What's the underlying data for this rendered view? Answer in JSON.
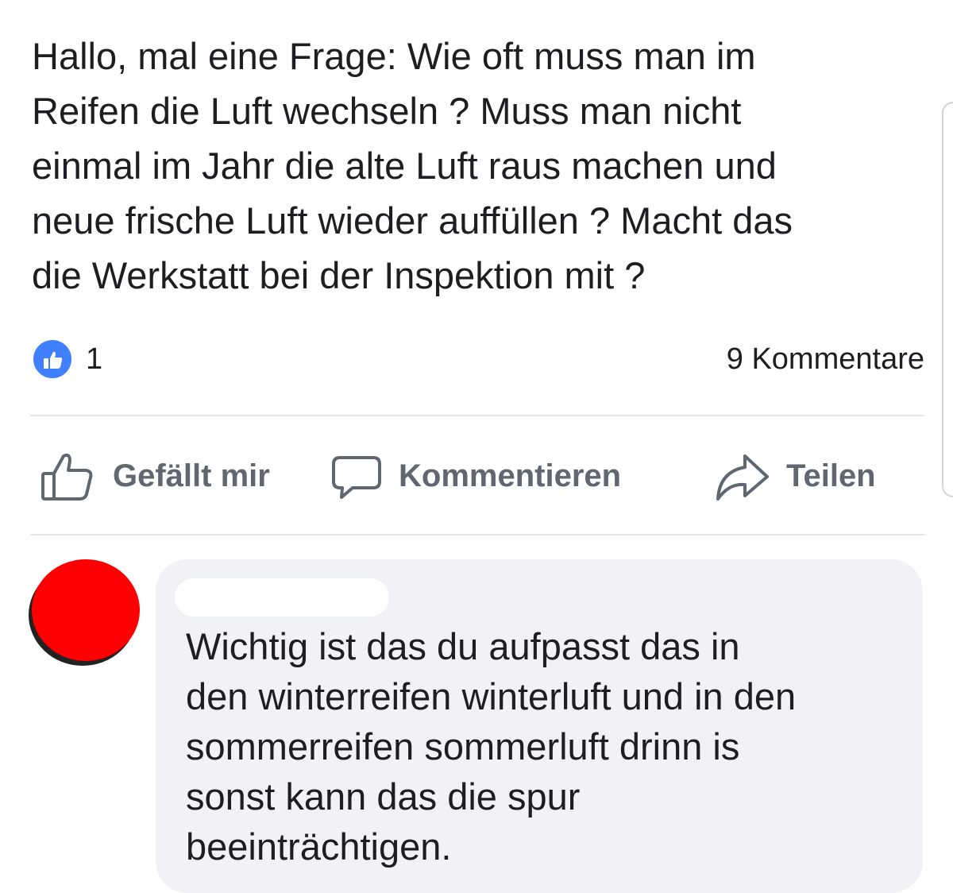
{
  "post": {
    "text_lines": [
      "Hallo, mal eine Frage: Wie oft muss man im",
      "Reifen die Luft wechseln ? Muss man nicht",
      "einmal im Jahr die alte Luft raus machen und",
      "neue frische Luft wieder auffüllen ? Macht das",
      "die Werkstatt bei der Inspektion mit ?"
    ]
  },
  "reactions": {
    "icon": "thumbs-up-icon",
    "like_count": "1",
    "comments_label": "9 Kommentare",
    "accent_color": "#4080ff"
  },
  "actions": {
    "like_label": "Gefällt mir",
    "comment_label": "Kommentieren",
    "share_label": "Teilen",
    "like_icon": "thumbs-up-outline-icon",
    "comment_icon": "speech-bubble-icon",
    "share_icon": "share-arrow-icon"
  },
  "comment": {
    "avatar_color": "#ff0000",
    "text_lines": [
      "Wichtig ist das du aufpasst das in",
      "den winterreifen winterluft und in den",
      "sommerreifen sommerluft drinn is",
      "sonst kann das die spur",
      "beeinträchtigen."
    ]
  }
}
